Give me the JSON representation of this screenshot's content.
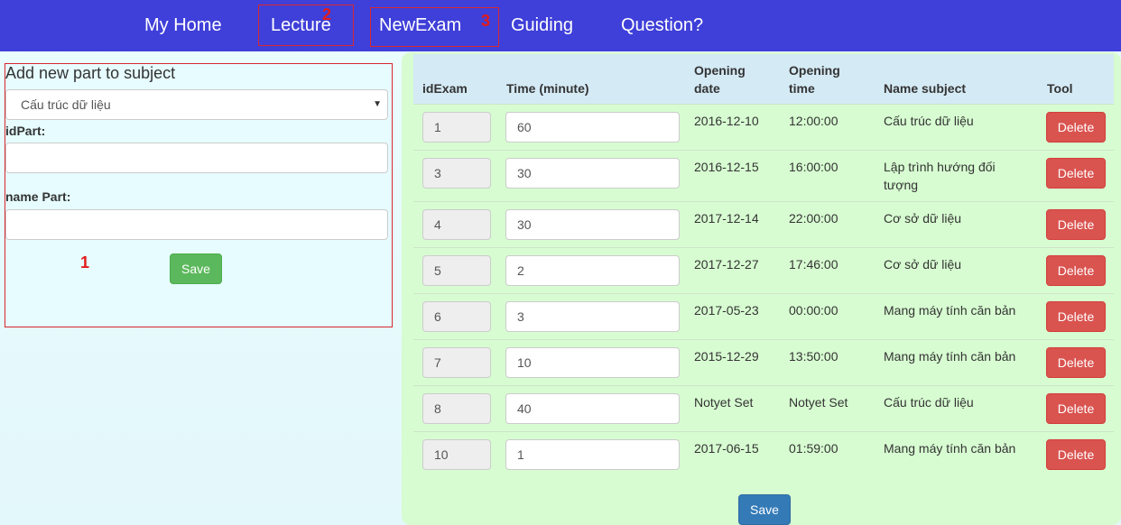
{
  "nav": {
    "items": [
      "My Home",
      "Lecture",
      "NewExam",
      "Guiding",
      "Question?"
    ],
    "annotations": [
      "2",
      "3"
    ]
  },
  "left_panel": {
    "title": "Add new part to subject",
    "subject_select": "Cấu trúc dữ liệu",
    "id_part_label": "idPart:",
    "id_part_value": "",
    "name_part_label": "name Part:",
    "name_part_value": "",
    "save_label": "Save",
    "annotation": "1"
  },
  "table": {
    "headers": {
      "id": "idExam",
      "time": "Time (minute)",
      "opening_date_1": "Opening",
      "opening_date_2": "date",
      "opening_time_1": "Opening",
      "opening_time_2": "time",
      "subject": "Name subject",
      "tool": "Tool"
    },
    "rows": [
      {
        "id": "1",
        "time": "60",
        "date": "2016-12-10",
        "clock": "12:00:00",
        "subject_1": "Cấu trúc dữ liệu",
        "subject_2": ""
      },
      {
        "id": "3",
        "time": "30",
        "date": "2016-12-15",
        "clock": "16:00:00",
        "subject_1": "Lập trình hướng đối",
        "subject_2": "tượng"
      },
      {
        "id": "4",
        "time": "30",
        "date": "2017-12-14",
        "clock": "22:00:00",
        "subject_1": "Cơ sở dữ liệu",
        "subject_2": ""
      },
      {
        "id": "5",
        "time": "2",
        "date": "2017-12-27",
        "clock": "17:46:00",
        "subject_1": "Cơ sở dữ liệu",
        "subject_2": ""
      },
      {
        "id": "6",
        "time": "3",
        "date": "2017-05-23",
        "clock": "00:00:00",
        "subject_1": "Mang máy tính căn bản",
        "subject_2": ""
      },
      {
        "id": "7",
        "time": "10",
        "date": "2015-12-29",
        "clock": "13:50:00",
        "subject_1": "Mang máy tính căn bản",
        "subject_2": ""
      },
      {
        "id": "8",
        "time": "40",
        "date": "Notyet Set",
        "clock": "Notyet Set",
        "subject_1": "Cấu trúc dữ liệu",
        "subject_2": ""
      },
      {
        "id": "10",
        "time": "1",
        "date": "2017-06-15",
        "clock": "01:59:00",
        "subject_1": "Mang máy tính căn bản",
        "subject_2": ""
      }
    ],
    "delete_label": "Delete",
    "save_label": "Save"
  },
  "colors": {
    "navbar": "#3f3fd9",
    "annotation": "#e21b1b",
    "delete": "#d9534f",
    "save_green": "#5cb85c",
    "save_blue": "#337ab7"
  }
}
